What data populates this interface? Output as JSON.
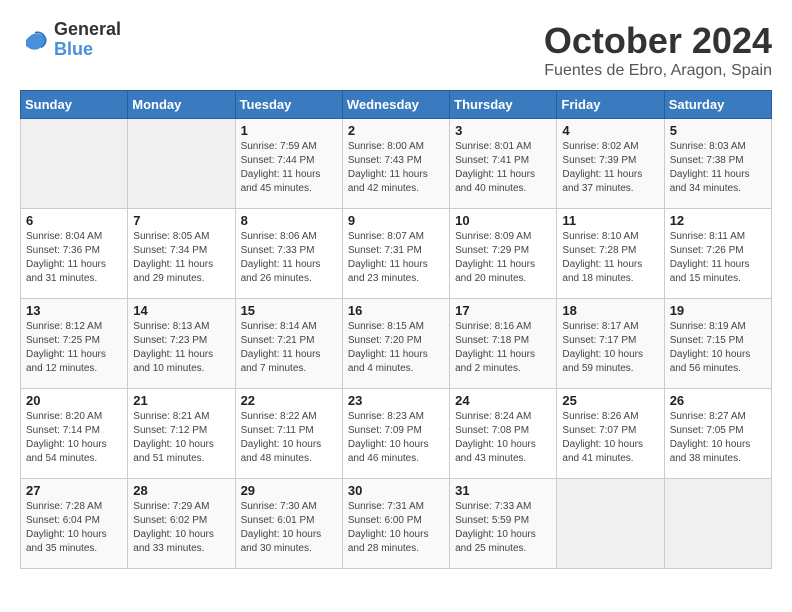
{
  "header": {
    "logo_line1": "General",
    "logo_line2": "Blue",
    "month": "October 2024",
    "location": "Fuentes de Ebro, Aragon, Spain"
  },
  "days_of_week": [
    "Sunday",
    "Monday",
    "Tuesday",
    "Wednesday",
    "Thursday",
    "Friday",
    "Saturday"
  ],
  "weeks": [
    [
      {
        "day": "",
        "info": ""
      },
      {
        "day": "",
        "info": ""
      },
      {
        "day": "1",
        "info": "Sunrise: 7:59 AM\nSunset: 7:44 PM\nDaylight: 11 hours and 45 minutes."
      },
      {
        "day": "2",
        "info": "Sunrise: 8:00 AM\nSunset: 7:43 PM\nDaylight: 11 hours and 42 minutes."
      },
      {
        "day": "3",
        "info": "Sunrise: 8:01 AM\nSunset: 7:41 PM\nDaylight: 11 hours and 40 minutes."
      },
      {
        "day": "4",
        "info": "Sunrise: 8:02 AM\nSunset: 7:39 PM\nDaylight: 11 hours and 37 minutes."
      },
      {
        "day": "5",
        "info": "Sunrise: 8:03 AM\nSunset: 7:38 PM\nDaylight: 11 hours and 34 minutes."
      }
    ],
    [
      {
        "day": "6",
        "info": "Sunrise: 8:04 AM\nSunset: 7:36 PM\nDaylight: 11 hours and 31 minutes."
      },
      {
        "day": "7",
        "info": "Sunrise: 8:05 AM\nSunset: 7:34 PM\nDaylight: 11 hours and 29 minutes."
      },
      {
        "day": "8",
        "info": "Sunrise: 8:06 AM\nSunset: 7:33 PM\nDaylight: 11 hours and 26 minutes."
      },
      {
        "day": "9",
        "info": "Sunrise: 8:07 AM\nSunset: 7:31 PM\nDaylight: 11 hours and 23 minutes."
      },
      {
        "day": "10",
        "info": "Sunrise: 8:09 AM\nSunset: 7:29 PM\nDaylight: 11 hours and 20 minutes."
      },
      {
        "day": "11",
        "info": "Sunrise: 8:10 AM\nSunset: 7:28 PM\nDaylight: 11 hours and 18 minutes."
      },
      {
        "day": "12",
        "info": "Sunrise: 8:11 AM\nSunset: 7:26 PM\nDaylight: 11 hours and 15 minutes."
      }
    ],
    [
      {
        "day": "13",
        "info": "Sunrise: 8:12 AM\nSunset: 7:25 PM\nDaylight: 11 hours and 12 minutes."
      },
      {
        "day": "14",
        "info": "Sunrise: 8:13 AM\nSunset: 7:23 PM\nDaylight: 11 hours and 10 minutes."
      },
      {
        "day": "15",
        "info": "Sunrise: 8:14 AM\nSunset: 7:21 PM\nDaylight: 11 hours and 7 minutes."
      },
      {
        "day": "16",
        "info": "Sunrise: 8:15 AM\nSunset: 7:20 PM\nDaylight: 11 hours and 4 minutes."
      },
      {
        "day": "17",
        "info": "Sunrise: 8:16 AM\nSunset: 7:18 PM\nDaylight: 11 hours and 2 minutes."
      },
      {
        "day": "18",
        "info": "Sunrise: 8:17 AM\nSunset: 7:17 PM\nDaylight: 10 hours and 59 minutes."
      },
      {
        "day": "19",
        "info": "Sunrise: 8:19 AM\nSunset: 7:15 PM\nDaylight: 10 hours and 56 minutes."
      }
    ],
    [
      {
        "day": "20",
        "info": "Sunrise: 8:20 AM\nSunset: 7:14 PM\nDaylight: 10 hours and 54 minutes."
      },
      {
        "day": "21",
        "info": "Sunrise: 8:21 AM\nSunset: 7:12 PM\nDaylight: 10 hours and 51 minutes."
      },
      {
        "day": "22",
        "info": "Sunrise: 8:22 AM\nSunset: 7:11 PM\nDaylight: 10 hours and 48 minutes."
      },
      {
        "day": "23",
        "info": "Sunrise: 8:23 AM\nSunset: 7:09 PM\nDaylight: 10 hours and 46 minutes."
      },
      {
        "day": "24",
        "info": "Sunrise: 8:24 AM\nSunset: 7:08 PM\nDaylight: 10 hours and 43 minutes."
      },
      {
        "day": "25",
        "info": "Sunrise: 8:26 AM\nSunset: 7:07 PM\nDaylight: 10 hours and 41 minutes."
      },
      {
        "day": "26",
        "info": "Sunrise: 8:27 AM\nSunset: 7:05 PM\nDaylight: 10 hours and 38 minutes."
      }
    ],
    [
      {
        "day": "27",
        "info": "Sunrise: 7:28 AM\nSunset: 6:04 PM\nDaylight: 10 hours and 35 minutes."
      },
      {
        "day": "28",
        "info": "Sunrise: 7:29 AM\nSunset: 6:02 PM\nDaylight: 10 hours and 33 minutes."
      },
      {
        "day": "29",
        "info": "Sunrise: 7:30 AM\nSunset: 6:01 PM\nDaylight: 10 hours and 30 minutes."
      },
      {
        "day": "30",
        "info": "Sunrise: 7:31 AM\nSunset: 6:00 PM\nDaylight: 10 hours and 28 minutes."
      },
      {
        "day": "31",
        "info": "Sunrise: 7:33 AM\nSunset: 5:59 PM\nDaylight: 10 hours and 25 minutes."
      },
      {
        "day": "",
        "info": ""
      },
      {
        "day": "",
        "info": ""
      }
    ]
  ]
}
